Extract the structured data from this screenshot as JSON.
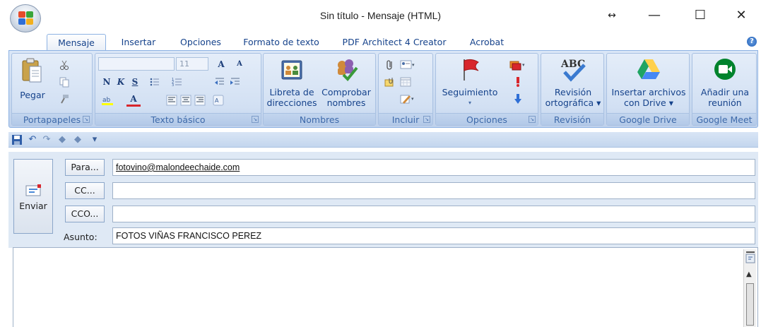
{
  "window": {
    "title": "Sin título - Mensaje (HTML)",
    "controls": {
      "resize": "↔",
      "minimize": "—",
      "maximize": "☐",
      "close": "✕"
    }
  },
  "tabs": [
    {
      "label": "Mensaje",
      "active": true
    },
    {
      "label": "Insertar"
    },
    {
      "label": "Opciones"
    },
    {
      "label": "Formato de texto"
    },
    {
      "label": "PDF Architect 4 Creator"
    },
    {
      "label": "Acrobat"
    }
  ],
  "help_icon": "?",
  "ribbon": {
    "portapapeles": {
      "label": "Portapapeles",
      "paste": "Pegar"
    },
    "texto_basico": {
      "label": "Texto básico",
      "font_size": "11",
      "bold": "N",
      "italic": "K",
      "underline": "S",
      "grow_font": "A",
      "shrink_font": "A",
      "font_color": "A"
    },
    "nombres": {
      "label": "Nombres",
      "libreta_line1": "Libreta de",
      "libreta_line2": "direcciones",
      "comprobar_line1": "Comprobar",
      "comprobar_line2": "nombres"
    },
    "incluir": {
      "label": "Incluir"
    },
    "opciones": {
      "label": "Opciones",
      "seguimiento": "Seguimiento"
    },
    "revision": {
      "label": "Revisión",
      "btn_line1": "Revisión",
      "btn_line2": "ortográfica ▾",
      "icon_text": "ABC"
    },
    "google_drive": {
      "label": "Google Drive",
      "btn_line1": "Insertar archivos",
      "btn_line2": "con Drive ▾"
    },
    "google_meet": {
      "label": "Google Meet",
      "btn_line1": "Añadir una",
      "btn_line2": "reunión"
    }
  },
  "qat": {
    "more": "▾"
  },
  "compose": {
    "send_label": "Enviar",
    "to_button": "Para...",
    "cc_button": "CC...",
    "bcc_button": "CCO...",
    "to_value": "fotovino@malondeechaide.com",
    "cc_value": "",
    "bcc_value": "",
    "subject_label": "Asunto:",
    "subject_value": "FOTOS VIÑAS FRANCISCO PEREZ"
  },
  "colors": {
    "ribbon_bg": "#c7d8ef",
    "tab_text": "#15428b",
    "header_bg": "#dfe9f5",
    "google_drive_green": "#1fa463",
    "google_drive_yellow": "#ffd04b",
    "google_drive_blue": "#4688f4",
    "meet_green": "#00832d",
    "flag_red": "#d8262c"
  }
}
